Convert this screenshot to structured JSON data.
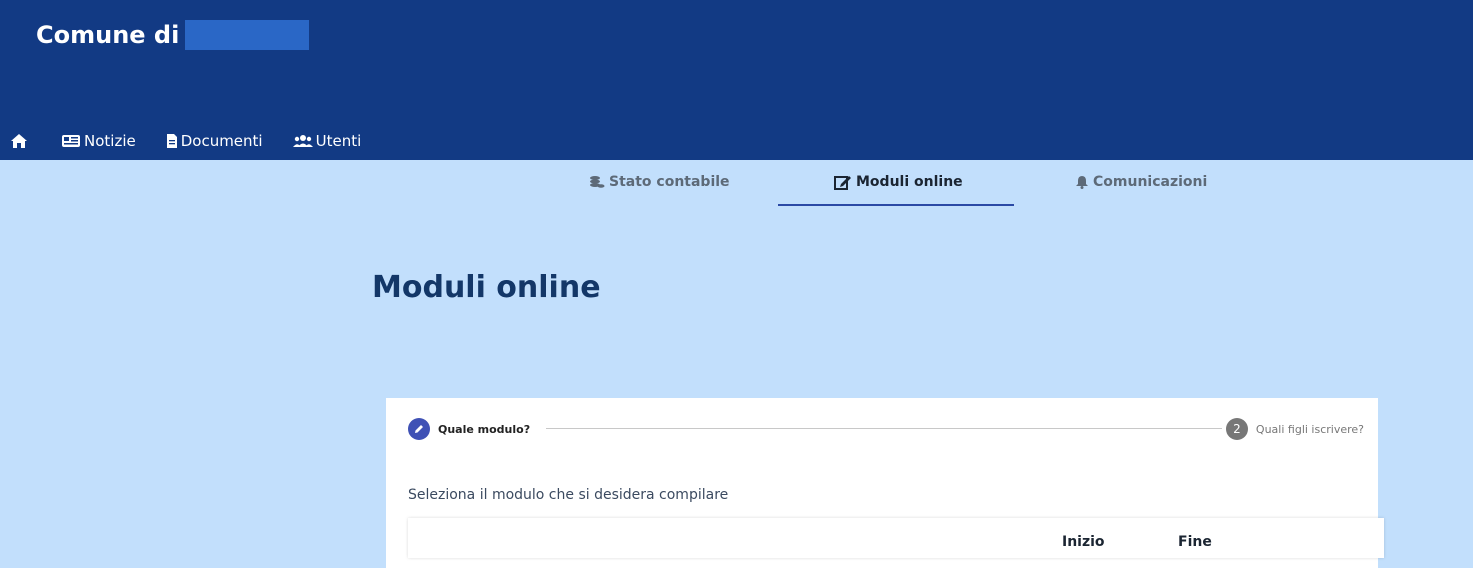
{
  "header": {
    "brand": "Comune di"
  },
  "nav": {
    "items": [
      {
        "label": "Notizie",
        "icon": "newspaper-icon"
      },
      {
        "label": "Documenti",
        "icon": "file-icon"
      },
      {
        "label": "Utenti",
        "icon": "users-icon"
      }
    ]
  },
  "tabs": [
    {
      "label": "Stato contabile",
      "icon": "coins-icon"
    },
    {
      "label": "Moduli online",
      "icon": "edit-icon",
      "active": true
    },
    {
      "label": "Comunicazioni",
      "icon": "bell-icon"
    }
  ],
  "main": {
    "title": "Moduli online",
    "stepper": {
      "step1": {
        "label": "Quale modulo?"
      },
      "step2": {
        "number": "2",
        "label": "Quali figli iscrivere?"
      }
    },
    "instruction": "Seleziona il modulo che si desidera compilare",
    "table": {
      "headers": [
        "Inizio",
        "Fine"
      ]
    }
  },
  "colors": {
    "header_bg": "#123a84",
    "page_bg": "#c2dffc",
    "accent": "#3f51b5",
    "title": "#133768"
  }
}
